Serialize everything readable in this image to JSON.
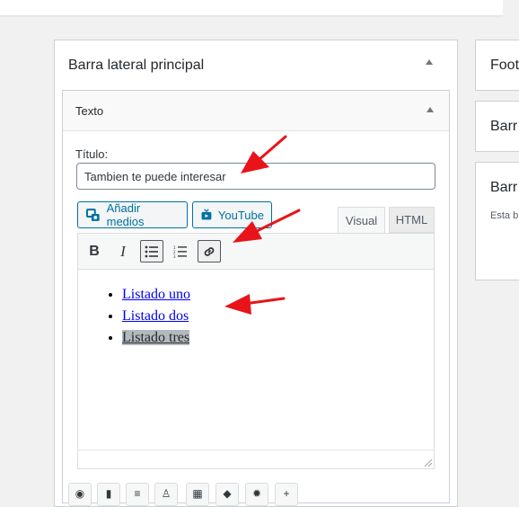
{
  "sidebar_panel": {
    "title": "Barra lateral principal"
  },
  "widget": {
    "title": "Texto",
    "title_label": "Título:",
    "title_value": "Tambien te puede interesar",
    "add_media": "Añadir medios",
    "youtube": "YouTube",
    "tab_visual": "Visual",
    "tab_html": "HTML",
    "toolbar": {
      "bold": "B",
      "italic": "I"
    },
    "list_items": [
      "Listado uno",
      "Listado dos",
      "Listado tres"
    ]
  },
  "right_column": {
    "box1_title": "Foot",
    "box2_title": "Barr",
    "box3_title": "Barr",
    "box3_text": "Esta b"
  },
  "colors": {
    "accent": "#0071a1",
    "annotation_arrow": "#e8141a",
    "selection": "#b4b9be"
  }
}
